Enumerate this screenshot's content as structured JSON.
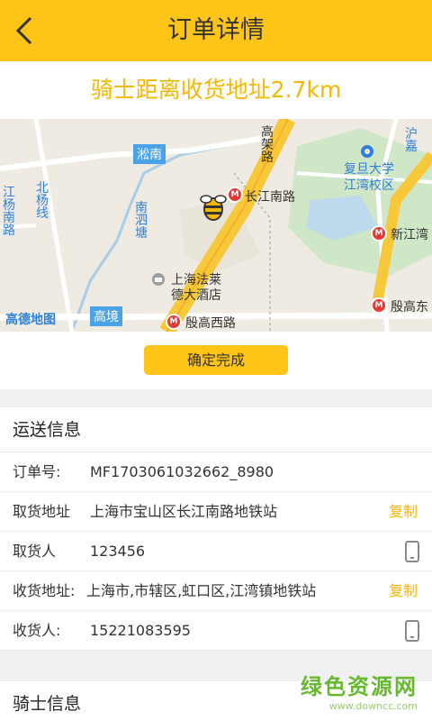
{
  "header": {
    "title": "订单详情",
    "back_icon": "chevron-left-icon"
  },
  "distance": {
    "text": "骑士距离收货地址2.7km"
  },
  "map": {
    "labels": {
      "songnan": "淞南",
      "changjiang_south_rd": "长江南路",
      "fudan_1": "复旦大学",
      "fudan_2": "江湾校区",
      "jiangbei": "江杨南路",
      "beiyang": "北杨线",
      "nansi": "南泗塘",
      "hotel_1": "上海法莱",
      "hotel_2": "德大酒店",
      "xinjiang": "新江湾",
      "yingaodong": "殷高东",
      "yingaoxi": "殷高西路",
      "gaojing": "高境",
      "hujia": "沪嘉",
      "ring": "高架路",
      "logo": "高德地图"
    }
  },
  "confirm": {
    "label": "确定完成"
  },
  "delivery": {
    "title": "运送信息",
    "order_no_label": "订单号:",
    "order_no": "MF1703061032662_8980",
    "pickup_addr_label": "取货地址",
    "pickup_addr": "上海市宝山区长江南路地铁站",
    "pickup_person_label": "取货人",
    "pickup_person": "123456",
    "receive_addr_label": "收货地址:",
    "receive_addr": "上海市,市辖区,虹口区,江湾镇地铁站",
    "receiver_label": "收货人:",
    "receiver": "15221083595",
    "copy_label": "复制"
  },
  "rider": {
    "title": "骑士信息"
  },
  "watermark": {
    "main": "绿色资源网",
    "sub": "www.downcc.com"
  },
  "colors": {
    "brand": "#fec418",
    "accent": "#f5b800",
    "watermark": "#66b82e"
  }
}
